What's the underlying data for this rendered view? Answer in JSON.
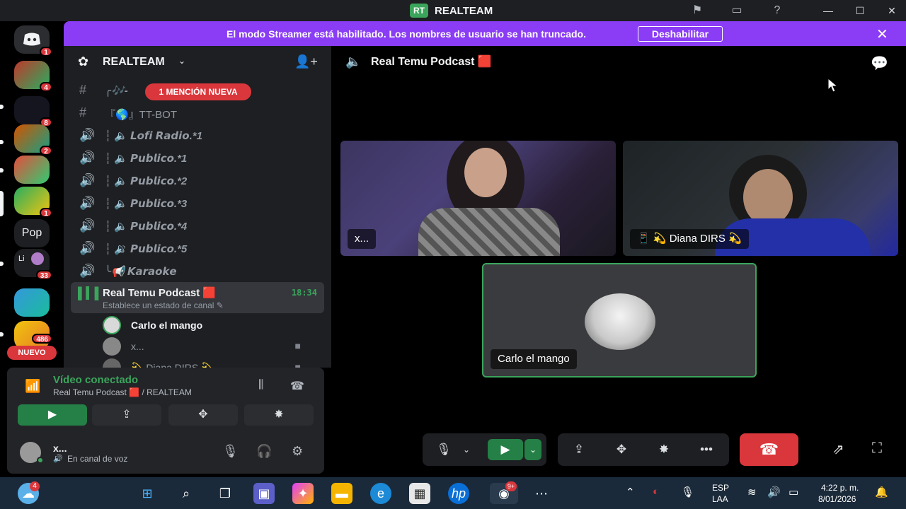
{
  "window": {
    "title": "REALTEAM",
    "logo_text": "RT"
  },
  "banner": {
    "text": "El modo Streamer está habilitado. Los nombres de usuario se han truncado.",
    "button_label": "Deshabilitar",
    "close_glyph": "✕"
  },
  "guilds": {
    "badges": [
      "1",
      "4",
      "8",
      "2",
      "1",
      "33",
      "486"
    ],
    "pop_label": "Pop",
    "li_label": "Li",
    "new_label": "NUEVO"
  },
  "sidebar": {
    "server_name": "REALTEAM",
    "mention_pill": "1 MENCIÓN NUEVA",
    "channels": [
      {
        "icon": "#",
        "name": "╭🎶-"
      },
      {
        "icon": "#",
        "name": "『🌎』TT-BOT"
      },
      {
        "icon": "🔊",
        "name": "┆ 🔈 𝙇𝙤𝙛𝙞 𝙍𝙖𝙙𝙞𝙤.*1"
      },
      {
        "icon": "🔊",
        "name": "┆ 🔈 𝙋𝙪𝙗𝙡𝙞𝙘𝙤.*1"
      },
      {
        "icon": "🔊",
        "name": "┆ 🔈 𝙋𝙪𝙗𝙡𝙞𝙘𝙤.*2"
      },
      {
        "icon": "🔊",
        "name": "┆ 🔈 𝙋𝙪𝙗𝙡𝙞𝙘𝙤.*3"
      },
      {
        "icon": "🔊",
        "name": "┆ 🔈 𝙋𝙪𝙗𝙡𝙞𝙘𝙤.*4"
      },
      {
        "icon": "🔊",
        "name": "┆ 🔉 𝙋𝙪𝙗𝙡𝙞𝙘𝙤.*5"
      },
      {
        "icon": "🔊",
        "name": "╰📢 𝙆𝙖𝙧𝙖𝙤𝙠𝙚"
      }
    ],
    "active_channel": {
      "name": "Real Temu Podcast 🟥",
      "status": "Establece un estado de canal ✎",
      "time": "18:34"
    },
    "voice_users": [
      {
        "name": "Carlo el mango"
      },
      {
        "name": "x..."
      },
      {
        "name": "💫 Diana DIRS 💫"
      }
    ]
  },
  "voice_panel": {
    "title": "Vídeo conectado",
    "subtitle": "Real Temu Podcast 🟥 / REALTEAM"
  },
  "user": {
    "name": "x...",
    "status": "En canal de voz"
  },
  "stage": {
    "channel_title": "Real Temu Podcast 🟥",
    "tiles": [
      {
        "label": "x..."
      },
      {
        "label": "📱 💫 Diana DIRS 💫"
      },
      {
        "label": "Carlo el mango"
      }
    ]
  },
  "taskbar": {
    "weather_badge": "4",
    "discord_badge": "9+",
    "lang_line1": "ESP",
    "lang_line2": "LAA",
    "time": "4:22 p. m.",
    "date": "8/01/2026"
  },
  "colors": {
    "banner": "#8a3df4",
    "accent_green": "#3ba55c",
    "danger_red": "#da373c"
  }
}
